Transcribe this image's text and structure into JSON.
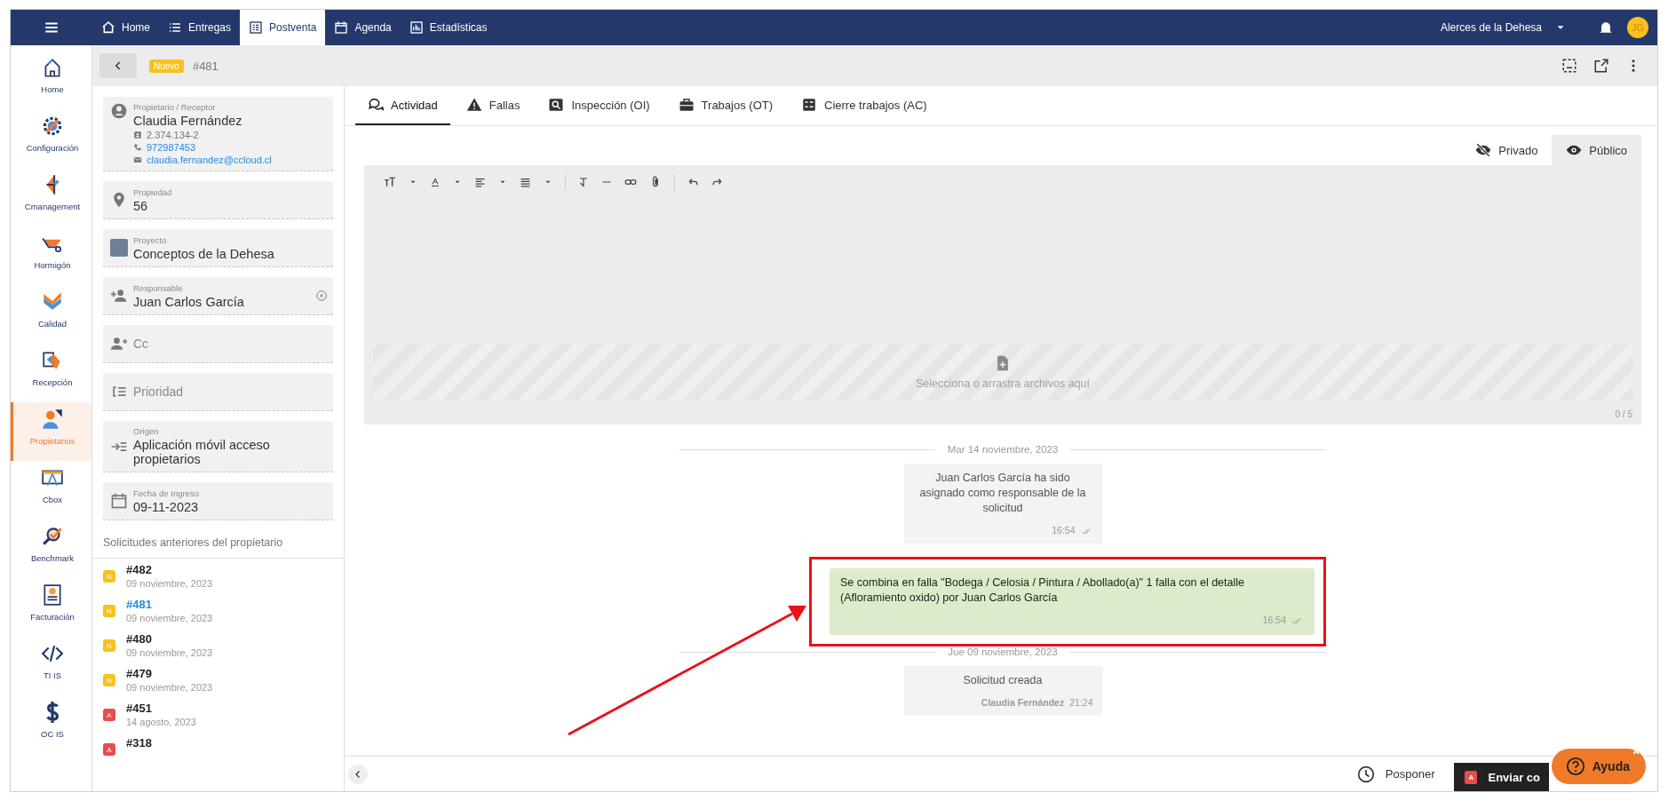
{
  "top_nav": {
    "items": [
      {
        "label": "Home",
        "selected": false
      },
      {
        "label": "Entregas",
        "selected": false
      },
      {
        "label": "Postventa",
        "selected": true
      },
      {
        "label": "Agenda",
        "selected": false
      },
      {
        "label": "Estadísticas",
        "selected": false
      }
    ],
    "project_selector": "Alerces de la Dehesa",
    "user_initials": "JG"
  },
  "sidebar": {
    "items": [
      {
        "label": "Home",
        "selected": false
      },
      {
        "label": "Configuración",
        "selected": false
      },
      {
        "label": "Cmanagement",
        "selected": false
      },
      {
        "label": "Hormigón",
        "selected": false
      },
      {
        "label": "Calidad",
        "selected": false
      },
      {
        "label": "Recepción",
        "selected": false
      },
      {
        "label": "Propietarios",
        "selected": true
      },
      {
        "label": "Cbox",
        "selected": false
      },
      {
        "label": "Benchmark",
        "selected": false
      },
      {
        "label": "Facturación",
        "selected": false
      },
      {
        "label": "TI IS",
        "selected": false
      },
      {
        "label": "OC IS",
        "selected": false
      }
    ]
  },
  "header": {
    "status_badge": "Nuevo",
    "ticket": "#481"
  },
  "details": {
    "owner": {
      "label": "Propietario / Receptor",
      "name": "Claudia Fernández",
      "rut": "2.374.134-2",
      "phone": "972987453",
      "email": "claudia.fernandez@ccloud.cl"
    },
    "fields": [
      {
        "kind": "property",
        "label": "Propiedad",
        "value": "56"
      },
      {
        "kind": "project",
        "label": "Proyecto",
        "value": "Conceptos de la Dehesa"
      },
      {
        "kind": "responsible",
        "label": "Responsable",
        "value": "Juan Carlos García"
      },
      {
        "kind": "cc",
        "placeholder": "Cc"
      },
      {
        "kind": "priority",
        "placeholder": "Prioridad"
      },
      {
        "kind": "origin",
        "label": "Origen",
        "value": "Aplicación móvil acceso propietarios"
      },
      {
        "kind": "date",
        "label": "Fecha de Ingreso",
        "value": "09-11-2023"
      }
    ]
  },
  "previous_requests": {
    "title": "Solicitudes anteriores del propietario",
    "items": [
      {
        "badge": "N",
        "color": "#f7c21c",
        "number": "#482",
        "date": "09 noviembre, 2023",
        "selected": false
      },
      {
        "badge": "N",
        "color": "#f7c21c",
        "number": "#481",
        "date": "09 noviembre, 2023",
        "selected": true
      },
      {
        "badge": "N",
        "color": "#f7c21c",
        "number": "#480",
        "date": "09 noviembre, 2023",
        "selected": false
      },
      {
        "badge": "N",
        "color": "#f7c21c",
        "number": "#479",
        "date": "09 noviembre, 2023",
        "selected": false
      },
      {
        "badge": "A",
        "color": "#e84c4c",
        "number": "#451",
        "date": "14 agosto, 2023",
        "selected": false
      },
      {
        "badge": "A",
        "color": "#e84c4c",
        "number": "#318",
        "selected": false
      }
    ]
  },
  "tabs": [
    {
      "label": "Actividad",
      "selected": true
    },
    {
      "label": "Fallas",
      "selected": false
    },
    {
      "label": "Inspección (OI)",
      "selected": false
    },
    {
      "label": "Trabajos (OT)",
      "selected": false
    },
    {
      "label": "Cierre trabajos (AC)",
      "selected": false
    }
  ],
  "visibility": [
    {
      "label": "Privado",
      "selected": false
    },
    {
      "label": "Público",
      "selected": true
    }
  ],
  "dropzone": {
    "text": "Selecciona o arrastra archivos aquí",
    "count": "0 / 5"
  },
  "feed": [
    {
      "kind": "date",
      "text": "Mar 14 noviembre, 2023"
    },
    {
      "kind": "system",
      "text": "Juan Carlos García ha sido asignado como responsable de la solicitud",
      "time": "16:54",
      "read": true
    },
    {
      "kind": "note",
      "text": "Se combina en falla \"Bodega / Celosia / Pintura / Abollado(a)\" 1 falla con el detalle (Afloramiento oxido) por Juan Carlos García",
      "time": "16:54",
      "read": true,
      "highlighted": true
    },
    {
      "kind": "date",
      "text": "Jue 09 noviembre, 2023"
    },
    {
      "kind": "system",
      "text": "Solicitud creada",
      "author": "Claudia Fernández",
      "time": "21:24",
      "read": false
    }
  ],
  "footer": {
    "postpone": "Posponer",
    "send_badge": "A",
    "send": "Enviar co",
    "help": "Ayuda"
  }
}
